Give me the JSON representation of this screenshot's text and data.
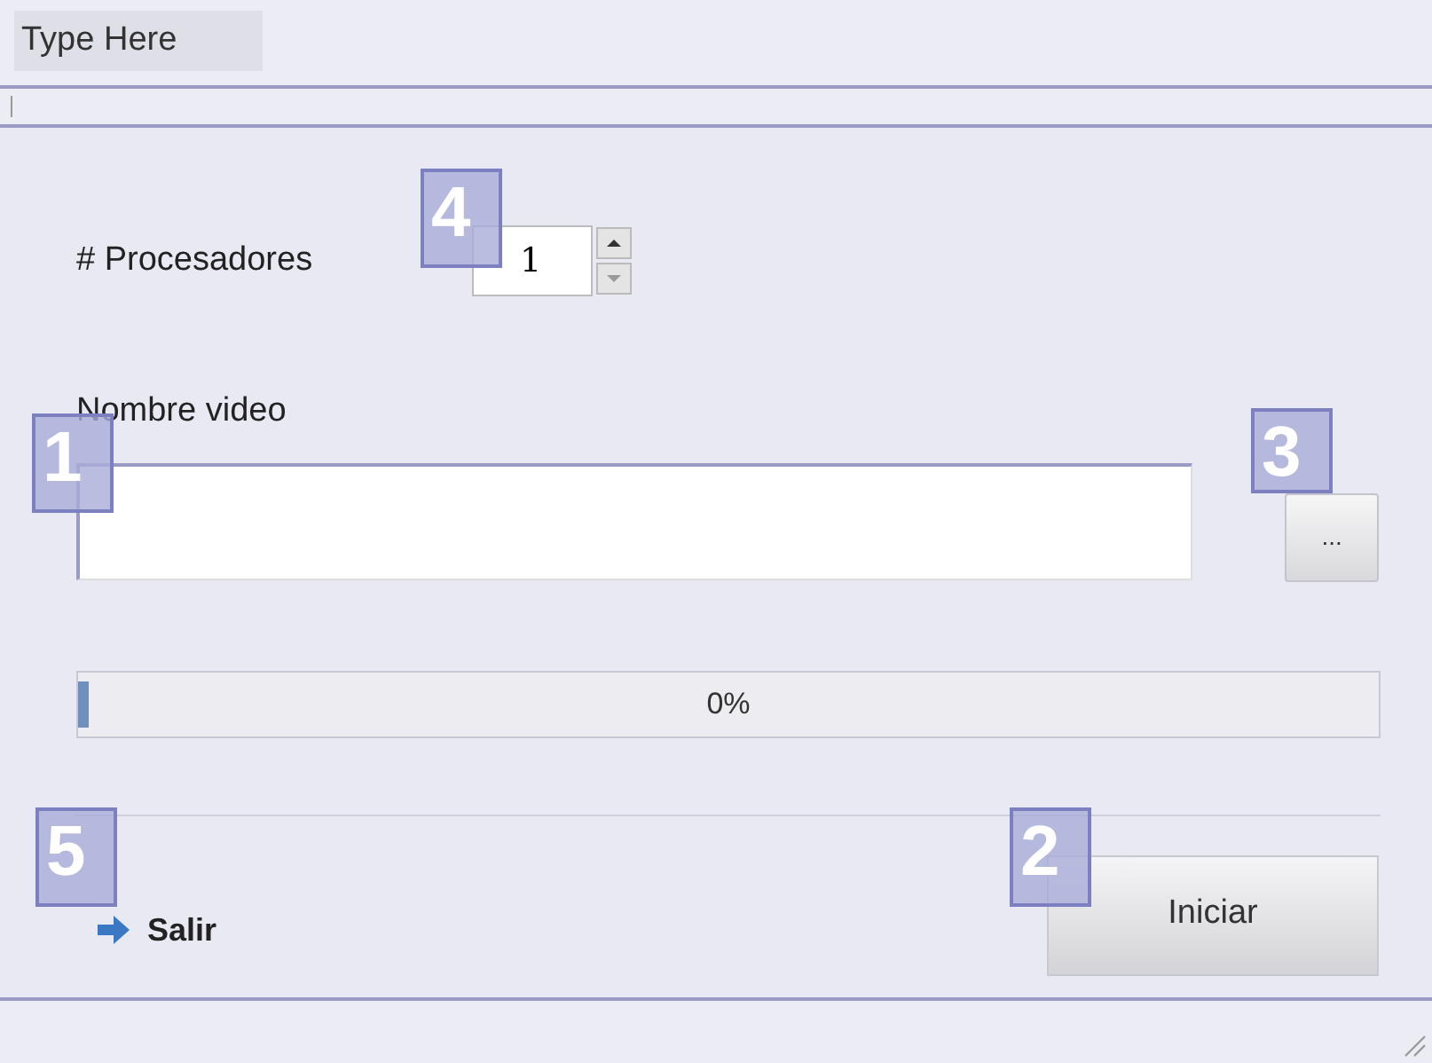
{
  "menu_bar": {
    "items": [
      "Type Here"
    ]
  },
  "processors": {
    "label": "# Procesadores",
    "value": "1"
  },
  "video": {
    "label": "Nombre video",
    "browse_button": "..."
  },
  "progress": {
    "level": 0,
    "reading": "0%"
  },
  "exit_link": "Salir",
  "start_button": "Iniciar",
  "callouts": {
    "processors": "4",
    "video_field": "1",
    "browse": "3",
    "exit": "5",
    "start": "2"
  }
}
